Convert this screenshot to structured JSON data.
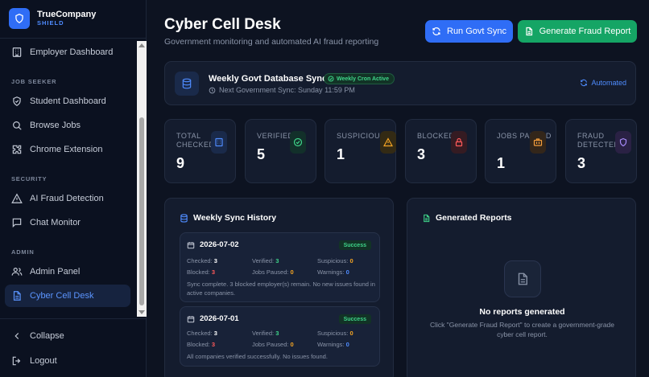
{
  "brand": {
    "name": "TrueCompany",
    "sub": "SHIELD"
  },
  "sidebar": {
    "items": [
      {
        "label": "Employer Dashboard"
      },
      {
        "label": "Student Dashboard"
      },
      {
        "label": "Browse Jobs"
      },
      {
        "label": "Chrome Extension"
      },
      {
        "label": "AI Fraud Detection"
      },
      {
        "label": "Chat Monitor"
      },
      {
        "label": "Admin Panel"
      },
      {
        "label": "Cyber Cell Desk"
      }
    ],
    "sections": {
      "job_seeker": "JOB SEEKER",
      "security": "SECURITY",
      "admin": "ADMIN"
    },
    "collapse": "Collapse",
    "logout": "Logout"
  },
  "header": {
    "title": "Cyber Cell Desk",
    "subtitle": "Government monitoring and automated AI fraud reporting",
    "run_sync": "Run Govt Sync",
    "generate_report": "Generate Fraud Report"
  },
  "sync": {
    "title": "Weekly Govt Database Sync",
    "badge": "Weekly Cron Active",
    "next": "Next Government Sync: Sunday 11:59 PM",
    "mode": "Automated"
  },
  "stats": [
    {
      "label": "TOTAL CHECKED",
      "value": "9",
      "color": "#4f8cff"
    },
    {
      "label": "VERIFIED",
      "value": "5",
      "color": "#3fd58a"
    },
    {
      "label": "SUSPICIOUS",
      "value": "1",
      "color": "#f5a524"
    },
    {
      "label": "BLOCKED",
      "value": "3",
      "color": "#ff5a5a"
    },
    {
      "label": "JOBS PAUSED",
      "value": "1",
      "color": "#f59e3c"
    },
    {
      "label": "FRAUD DETECTED",
      "value": "3",
      "color": "#a78bfa"
    }
  ],
  "history": {
    "title": "Weekly Sync History",
    "labels": {
      "checked": "Checked:",
      "verified": "Verified:",
      "suspicious": "Suspicious:",
      "blocked": "Blocked:",
      "paused": "Jobs Paused:",
      "warnings": "Warnings:"
    },
    "entries": [
      {
        "date": "2026-07-02",
        "status": "Success",
        "checked": "3",
        "verified": "3",
        "suspicious": "0",
        "blocked": "3",
        "paused": "0",
        "warnings": "0",
        "note": "Sync complete. 3 blocked employer(s) remain. No new issues found in active companies."
      },
      {
        "date": "2026-07-01",
        "status": "Success",
        "checked": "3",
        "verified": "3",
        "suspicious": "0",
        "blocked": "3",
        "paused": "0",
        "warnings": "0",
        "note": "All companies verified successfully. No issues found."
      }
    ]
  },
  "reports": {
    "title": "Generated Reports",
    "empty_title": "No reports generated",
    "empty_desc": "Click \"Generate Fraud Report\" to create a government-grade cyber cell report."
  }
}
